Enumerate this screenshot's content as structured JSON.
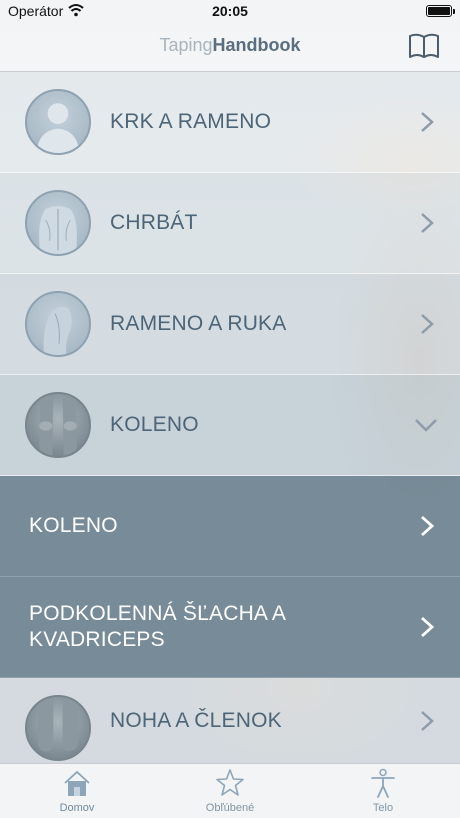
{
  "status_bar": {
    "carrier": "Operátor",
    "time": "20:05"
  },
  "nav": {
    "title_light": "Taping",
    "title_bold": "Handbook",
    "icon": "book-icon"
  },
  "categories": [
    {
      "label": "KRK A RAMENO",
      "icon": "head-shoulders-icon",
      "expanded": false
    },
    {
      "label": "CHRBÁT",
      "icon": "back-icon",
      "expanded": false
    },
    {
      "label": "RAMENO A RUKA",
      "icon": "arm-icon",
      "expanded": false
    },
    {
      "label": "KOLENO",
      "icon": "knee-icon",
      "expanded": true
    },
    {
      "label": "NOHA A ČLENOK",
      "icon": "feet-icon",
      "expanded": false
    }
  ],
  "subitems": [
    {
      "label": "KOLENO"
    },
    {
      "label_line1": "PODKOLENNÁ ŠĽACHA A",
      "label_line2": "KVADRICEPS"
    }
  ],
  "tab_bar": {
    "home": "Domov",
    "favorites": "Obľúbené",
    "body": "Telo"
  },
  "colors": {
    "accent": "#4d6577",
    "submenu": "#6e8391",
    "tab_icon": "#8da5b8"
  }
}
